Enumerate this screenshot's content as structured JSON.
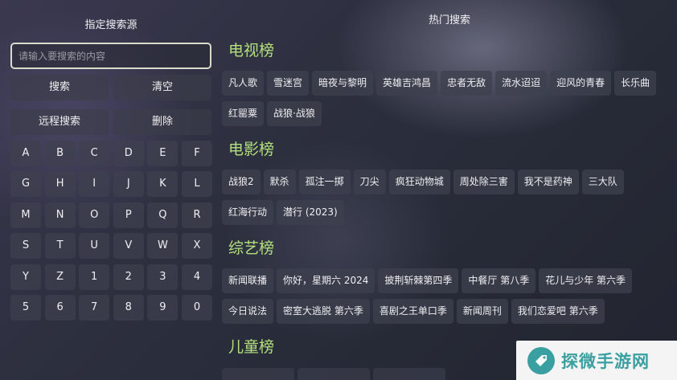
{
  "left": {
    "title": "指定搜索源",
    "search_placeholder": "请输入要搜索的内容",
    "buttons": {
      "search": "搜索",
      "clear": "清空",
      "remote": "远程搜索",
      "delete": "删除"
    },
    "keys": [
      "A",
      "B",
      "C",
      "D",
      "E",
      "F",
      "G",
      "H",
      "I",
      "J",
      "K",
      "L",
      "M",
      "N",
      "O",
      "P",
      "Q",
      "R",
      "S",
      "T",
      "U",
      "V",
      "W",
      "X",
      "Y",
      "Z",
      "1",
      "2",
      "3",
      "4",
      "5",
      "6",
      "7",
      "8",
      "9",
      "0"
    ]
  },
  "right": {
    "title": "热门搜索",
    "sections": [
      {
        "title": "电视榜",
        "rows": [
          [
            "凡人歌",
            "雪迷宫",
            "暗夜与黎明",
            "英雄吉鸿昌",
            "忠者无敌",
            "流水迢迢",
            "迎风的青春",
            "长乐曲"
          ],
          [
            "红罂粟",
            "战狼·战狼"
          ]
        ]
      },
      {
        "title": "电影榜",
        "rows": [
          [
            "战狼2",
            "默杀",
            "孤注一掷",
            "刀尖",
            "疯狂动物城",
            "周处除三害",
            "我不是药神",
            "三大队"
          ],
          [
            "红海行动",
            "潜行 (2023)"
          ]
        ]
      },
      {
        "title": "综艺榜",
        "rows": [
          [
            "新闻联播",
            "你好，星期六 2024",
            "披荆斩棘第四季",
            "中餐厅 第八季",
            "花儿与少年 第六季"
          ],
          [
            "今日说法",
            "密室大逃脱 第六季",
            "喜剧之王单口季",
            "新闻周刊",
            "我们恋爱吧 第六季"
          ]
        ]
      },
      {
        "title": "儿童榜",
        "rows": []
      }
    ]
  },
  "watermark": {
    "text": "探微手游网",
    "accent": "#3a9fa0"
  },
  "colors": {
    "section_title": "#b3e07c",
    "search_border": "#d9dccb"
  }
}
